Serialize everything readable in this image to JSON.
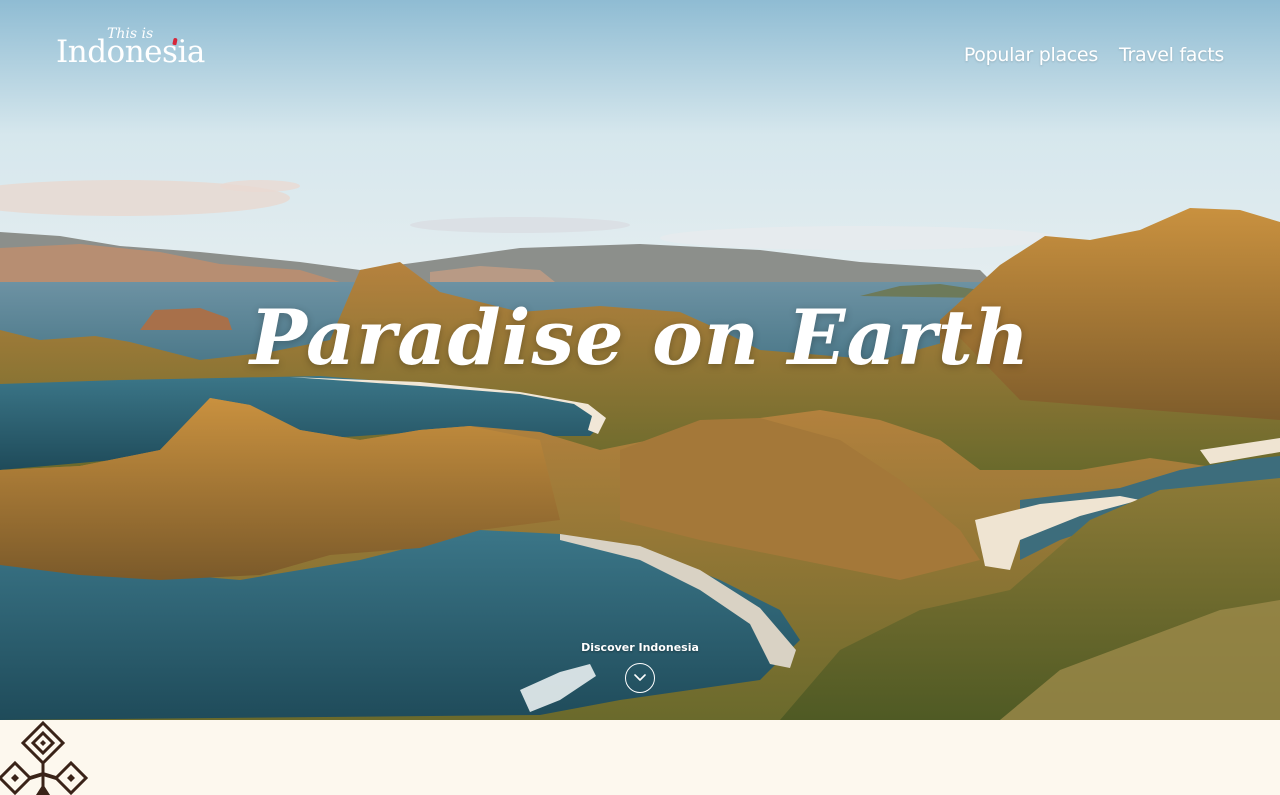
{
  "logo": {
    "small_text": "This is",
    "big_text": "Indonesia",
    "accent_color": "#d6263a"
  },
  "nav": {
    "items": [
      {
        "label": "Popular places"
      },
      {
        "label": "Travel facts"
      }
    ]
  },
  "hero": {
    "headline": "Paradise on Earth",
    "discover_label": "Discover Indonesia",
    "discover_icon": "chevron-down-icon"
  },
  "colors": {
    "band_background": "#fdf8ee",
    "ornament": "#3a2318",
    "text": "#ffffff"
  },
  "ornament": {
    "icon": "tribal-diamond-ornament-icon"
  }
}
